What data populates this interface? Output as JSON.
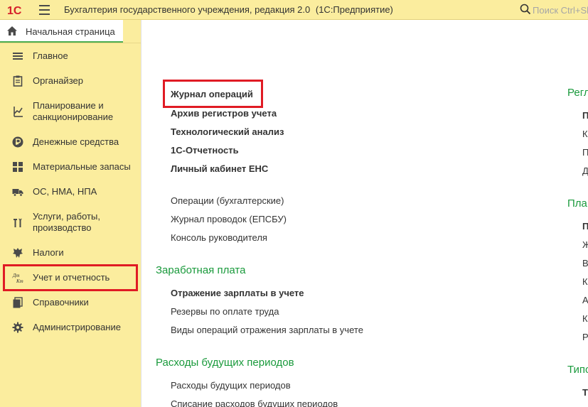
{
  "app": {
    "logo_text": "1С",
    "title": "Бухгалтерия государственного учреждения, редакция 2.0",
    "platform": "(1С:Предприятие)"
  },
  "search": {
    "placeholder": "Поиск Ctrl+Shift+F"
  },
  "home_tab": {
    "label": "Начальная страница"
  },
  "sidebar": {
    "items": [
      {
        "label": "Главное",
        "icon": "list-icon"
      },
      {
        "label": "Органайзер",
        "icon": "clipboard-icon"
      },
      {
        "label": "Планирование и санкционирование",
        "icon": "planning-icon"
      },
      {
        "label": "Денежные средства",
        "icon": "ruble-coin-icon"
      },
      {
        "label": "Материальные запасы",
        "icon": "grid-icon"
      },
      {
        "label": "ОС, НМА, НПА",
        "icon": "truck-icon"
      },
      {
        "label": "Услуги, работы, производство",
        "icon": "tools-icon"
      },
      {
        "label": "Налоги",
        "icon": "emblem-icon"
      },
      {
        "label": "Учет и отчетность",
        "icon": "debit-credit-icon",
        "icon_text": "Дт Кт"
      },
      {
        "label": "Справочники",
        "icon": "books-icon"
      },
      {
        "label": "Администрирование",
        "icon": "gear-icon"
      }
    ]
  },
  "main": {
    "col1": {
      "bold_links": [
        "Журнал операций",
        "Архив регистров учета",
        "Технологический анализ",
        "1С-Отчетность",
        "Личный кабинет ЕНС"
      ],
      "links": [
        "Операции (бухгалтерские)",
        "Журнал проводок (ЕПСБУ)",
        "Консоль руководителя"
      ],
      "salary": {
        "title": "Заработная плата",
        "bold_link": "Отражение зарплаты в учете",
        "links": [
          "Резервы по оплате труда",
          "Виды операций отражения зарплаты в учете"
        ]
      },
      "deferred": {
        "title": "Расходы будущих периодов",
        "links": [
          "Расходы будущих периодов",
          "Списание расходов будущих периодов"
        ]
      }
    },
    "col2": {
      "sec1": {
        "title": "Регл",
        "lines": [
          "П",
          "К",
          "П",
          "Д"
        ]
      },
      "sec2": {
        "title": "Пла",
        "lines": [
          "П",
          "Ж",
          "В",
          "К",
          "А",
          "К",
          "Р"
        ]
      },
      "sec3": {
        "title": "Типо",
        "lines": [
          "Т"
        ]
      }
    }
  },
  "colors": {
    "accent_green": "#1a9a3c",
    "panel_yellow": "#fbed9e",
    "highlight_red": "#e01b24",
    "logo_red": "#d5202a"
  }
}
